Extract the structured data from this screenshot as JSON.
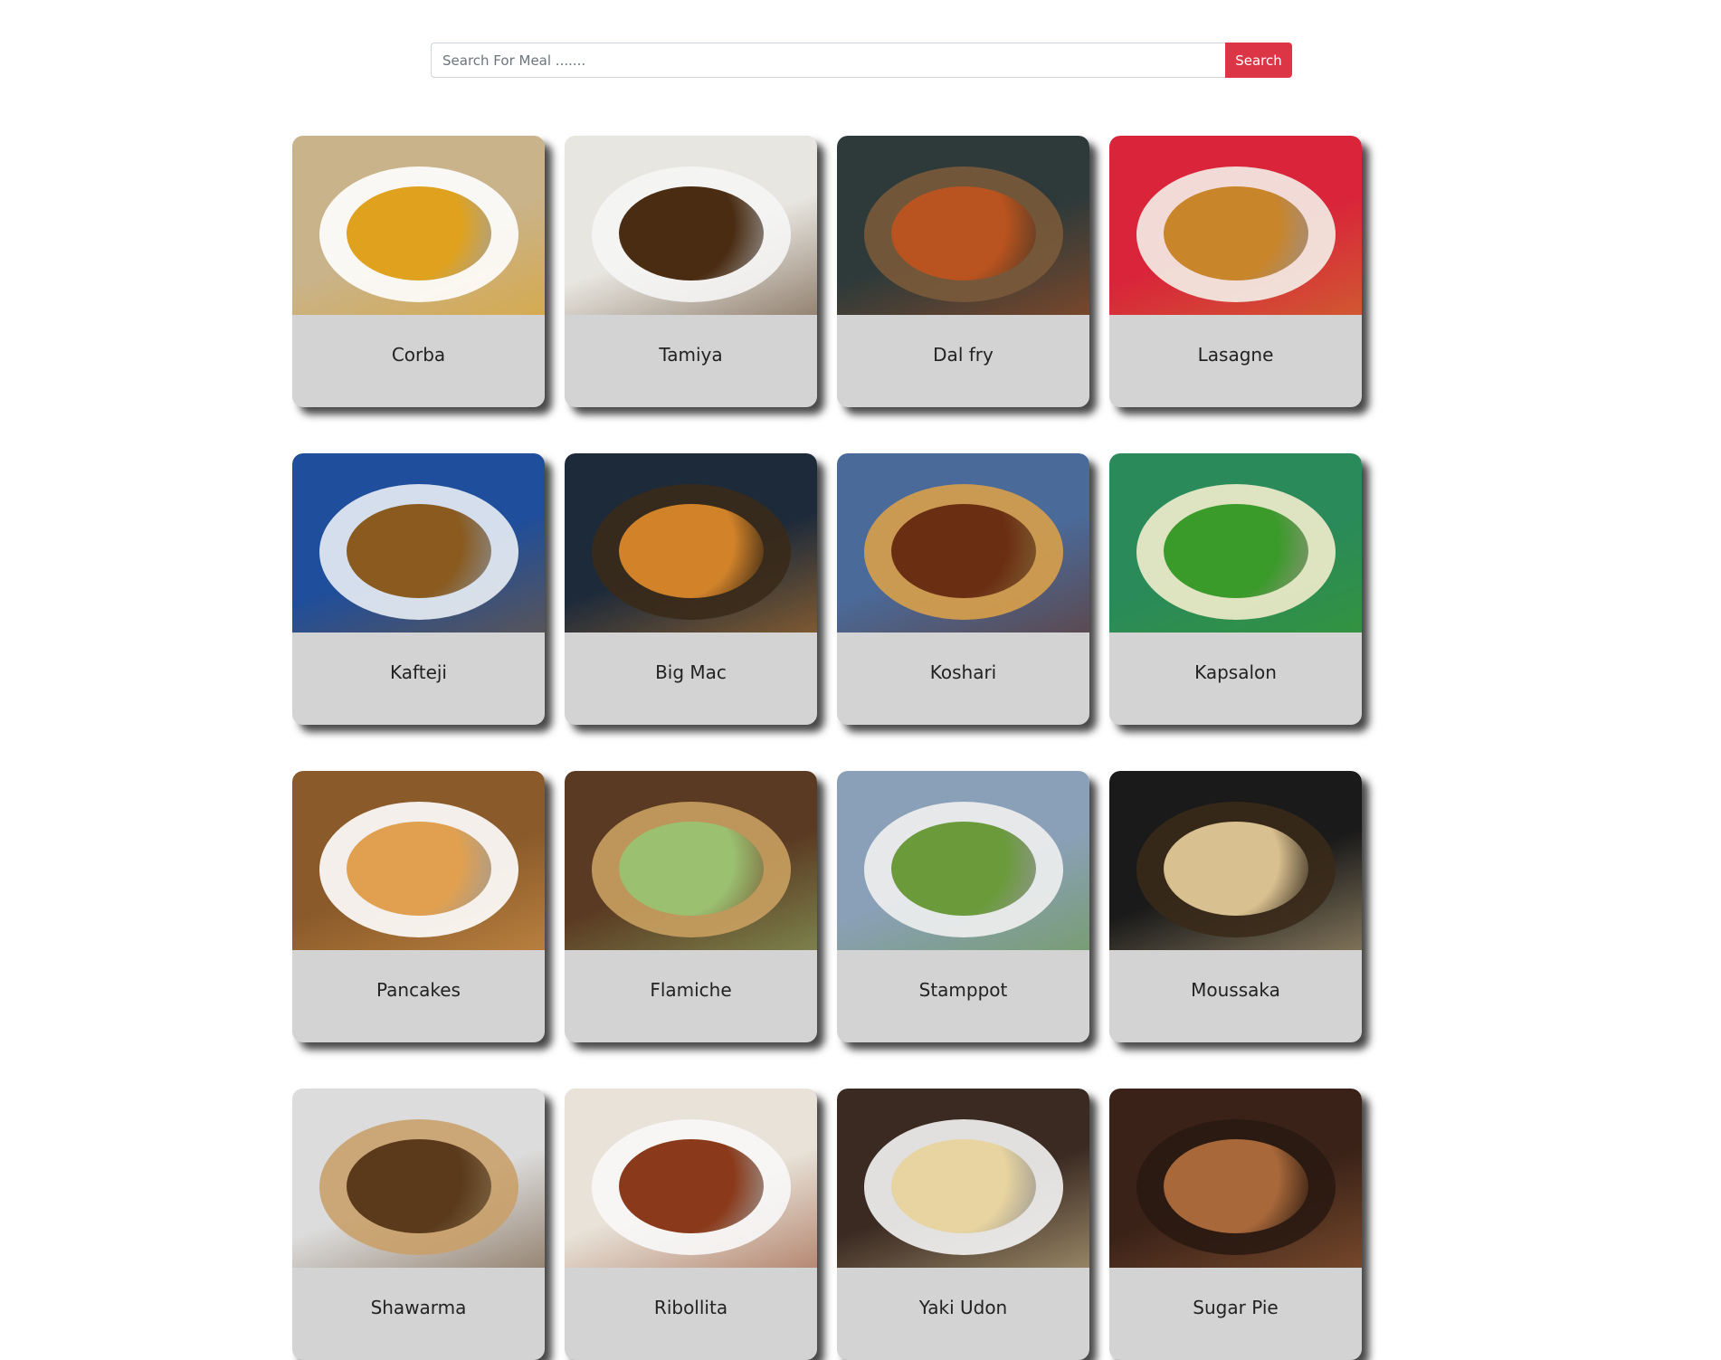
{
  "search": {
    "placeholder": "Search For Meal .......",
    "value": "",
    "button_label": "Search",
    "button_color": "#dc3545"
  },
  "meals": [
    {
      "name": "Corba",
      "image_colors": [
        "#c9b38a",
        "#ffffff",
        "#e0a21e"
      ]
    },
    {
      "name": "Tamiya",
      "image_colors": [
        "#e8e6e0",
        "#f5f5f5",
        "#4a2c12"
      ]
    },
    {
      "name": "Dal fry",
      "image_colors": [
        "#2e3a3a",
        "#7a5a3a",
        "#b9531f"
      ]
    },
    {
      "name": "Lasagne",
      "image_colors": [
        "#d9243a",
        "#f4efe8",
        "#c9852a"
      ]
    },
    {
      "name": "Kafteji",
      "image_colors": [
        "#1f4e9c",
        "#e9eef5",
        "#8a5a1e"
      ]
    },
    {
      "name": "Big Mac",
      "image_colors": [
        "#1d2a3a",
        "#3a2a1a",
        "#d2832a"
      ]
    },
    {
      "name": "Koshari",
      "image_colors": [
        "#4a6a9a",
        "#d8a04a",
        "#6a2e12"
      ]
    },
    {
      "name": "Kapsalon",
      "image_colors": [
        "#2a8a5a",
        "#f2eccc",
        "#3a9a2a"
      ]
    },
    {
      "name": "Pancakes",
      "image_colors": [
        "#8a5a2a",
        "#ffffff",
        "#e0a050"
      ]
    },
    {
      "name": "Flamiche",
      "image_colors": [
        "#5a3a22",
        "#c9a060",
        "#9ac070"
      ]
    },
    {
      "name": "Stamppot",
      "image_colors": [
        "#8aa0b8",
        "#f0f0f0",
        "#6a9a3a"
      ]
    },
    {
      "name": "Moussaka",
      "image_colors": [
        "#1a1a1a",
        "#3a2a1a",
        "#d9c090"
      ]
    },
    {
      "name": "Shawarma",
      "image_colors": [
        "#dcdcdc",
        "#c9a06a",
        "#5a3a1a"
      ]
    },
    {
      "name": "Ribollita",
      "image_colors": [
        "#e8e2d8",
        "#f8f8f8",
        "#8a3a1a"
      ]
    },
    {
      "name": "Yaki Udon",
      "image_colors": [
        "#3a2a22",
        "#f4f4f4",
        "#e8d4a0"
      ]
    },
    {
      "name": "Sugar Pie",
      "image_colors": [
        "#3a2218",
        "#2a1a12",
        "#a8683a"
      ]
    }
  ]
}
